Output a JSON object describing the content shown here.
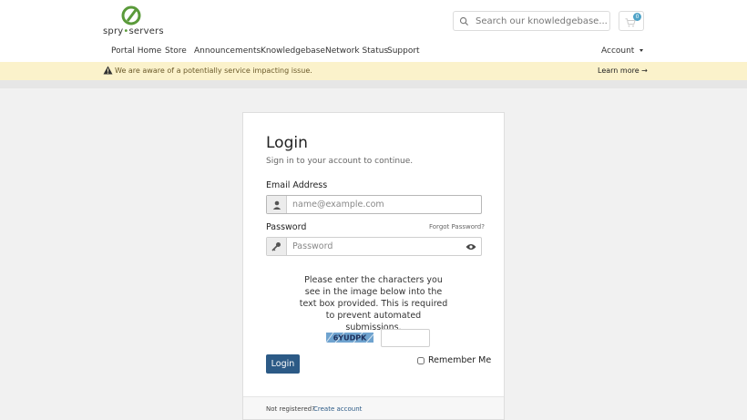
{
  "brand": {
    "name_left": "spry",
    "name_sep": "•",
    "name_right": "servers"
  },
  "search": {
    "placeholder": "Search our knowledgebase..."
  },
  "cart": {
    "count": "0"
  },
  "nav": {
    "items": [
      {
        "label": "Portal Home"
      },
      {
        "label": "Store"
      },
      {
        "label": "Announcements"
      },
      {
        "label": "Knowledgebase"
      },
      {
        "label": "Network Status"
      },
      {
        "label": "Support"
      }
    ],
    "account_label": "Account"
  },
  "alert": {
    "message": "We are aware of a potentially service impacting issue.",
    "link_label": "Learn more",
    "link_arrow": "→"
  },
  "login": {
    "title": "Login",
    "subtitle": "Sign in to your account to continue.",
    "email_label": "Email Address",
    "email_placeholder": "name@example.com",
    "password_label": "Password",
    "forgot_label": "Forgot Password?",
    "password_placeholder": "Password",
    "captcha_text": "Please enter the characters you see in the image below into the text box provided. This is required to prevent automated submissions.",
    "captcha_code": "6YUDPK",
    "submit_label": "Login",
    "remember_label": "Remember Me",
    "footer_text": "Not registered?",
    "footer_link": "Create account"
  },
  "colors": {
    "primary": "#2c5a86",
    "alert_bg": "#fbf2cb",
    "brand_green": "#5a9a3a",
    "badge": "#4fa3c7"
  }
}
